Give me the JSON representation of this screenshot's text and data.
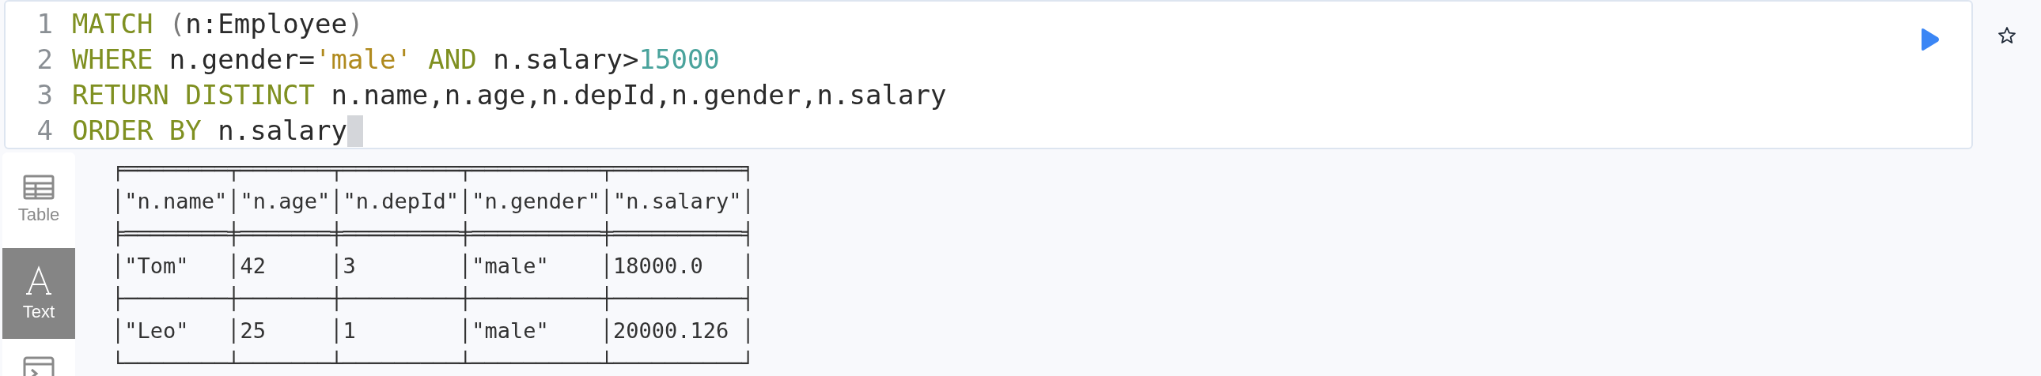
{
  "editor": {
    "lines": [
      {
        "number": "1",
        "cursor": false,
        "tokens": [
          {
            "kind": "keyword",
            "text": "MATCH"
          },
          {
            "kind": "punct",
            "text": " ("
          },
          {
            "kind": "plain",
            "text": "n:Employee"
          },
          {
            "kind": "punct",
            "text": ")"
          }
        ]
      },
      {
        "number": "2",
        "cursor": false,
        "tokens": [
          {
            "kind": "keyword",
            "text": "WHERE"
          },
          {
            "kind": "plain",
            "text": " n.gender="
          },
          {
            "kind": "string",
            "text": "'male'"
          },
          {
            "kind": "keyword",
            "text": " AND"
          },
          {
            "kind": "plain",
            "text": " n.salary>"
          },
          {
            "kind": "number",
            "text": "15000"
          }
        ]
      },
      {
        "number": "3",
        "cursor": false,
        "tokens": [
          {
            "kind": "keyword",
            "text": "RETURN DISTINCT"
          },
          {
            "kind": "plain",
            "text": " n.name,n.age,n.depId,n.gender,n.salary"
          }
        ]
      },
      {
        "number": "4",
        "cursor": true,
        "tokens": [
          {
            "kind": "keyword",
            "text": "ORDER BY"
          },
          {
            "kind": "plain",
            "text": " n.salary"
          }
        ]
      }
    ]
  },
  "sidebar": {
    "items": [
      {
        "kind": "table",
        "label": "Table",
        "selected": false
      },
      {
        "kind": "text",
        "label": "Text",
        "selected": true
      },
      {
        "kind": "code",
        "selected": false
      }
    ]
  },
  "text_output": {
    "lines": [
      "╒════════╤═══════╤═════════╤══════════╤══════════╕",
      "│\"n.name\"│\"n.age\"│\"n.depId\"│\"n.gender\"│\"n.salary\"│",
      "╞════════╪═══════╪═════════╪══════════╪══════════╡",
      "│\"Tom\"   │42     │3        │\"male\"    │18000.0   │",
      "├────────┼───────┼─────────┼──────────┼──────────┤",
      "│\"Leo\"   │25     │1        │\"male\"    │20000.126 │",
      "└────────┴───────┴─────────┴──────────┴──────────┘"
    ]
  }
}
